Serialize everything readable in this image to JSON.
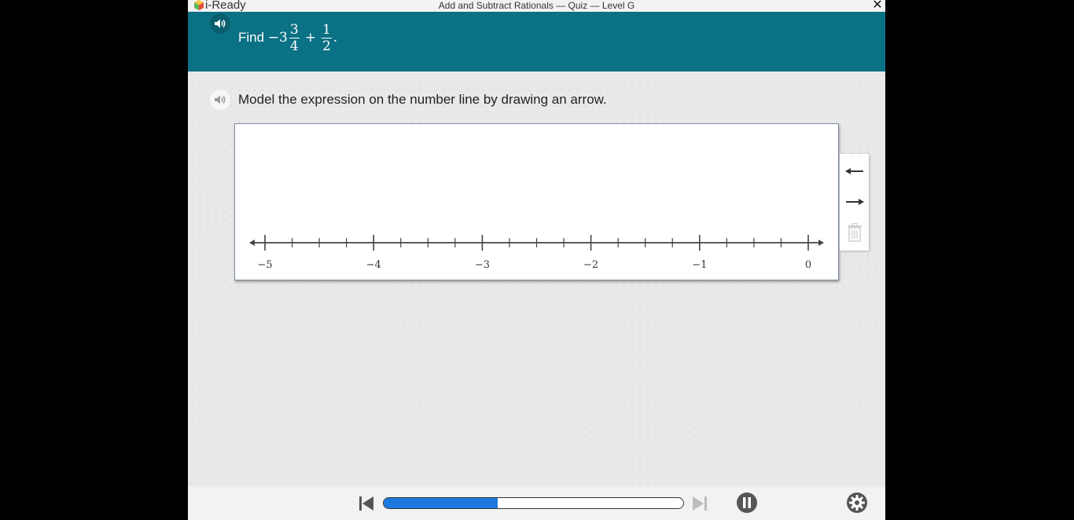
{
  "app": {
    "logo_text": "i-Ready",
    "window_title": "Add and Subtract Rationals — Quiz — Level G",
    "close_glyph": "✕"
  },
  "question": {
    "prefix": "Find ",
    "whole": "−3",
    "frac1_num": "3",
    "frac1_den": "4",
    "operator": "+",
    "frac2_num": "1",
    "frac2_den": "2",
    "end": "."
  },
  "instruction": "Model the expression on the number line by drawing an arrow.",
  "number_line": {
    "min": -5,
    "max": 0,
    "minor_step": 0.25,
    "labels": [
      "−5",
      "−4",
      "−3",
      "−2",
      "−1",
      "0"
    ]
  },
  "tools": [
    {
      "name": "left-arrow-tool",
      "icon": "arrow-left-icon"
    },
    {
      "name": "right-arrow-tool",
      "icon": "arrow-right-icon"
    },
    {
      "name": "delete-tool",
      "icon": "trash-icon"
    }
  ],
  "footer": {
    "progress": 0.38,
    "progress_color": "#1b78de"
  },
  "colors": {
    "header_bg": "#0b7185",
    "accent_blue": "#1b78de"
  }
}
